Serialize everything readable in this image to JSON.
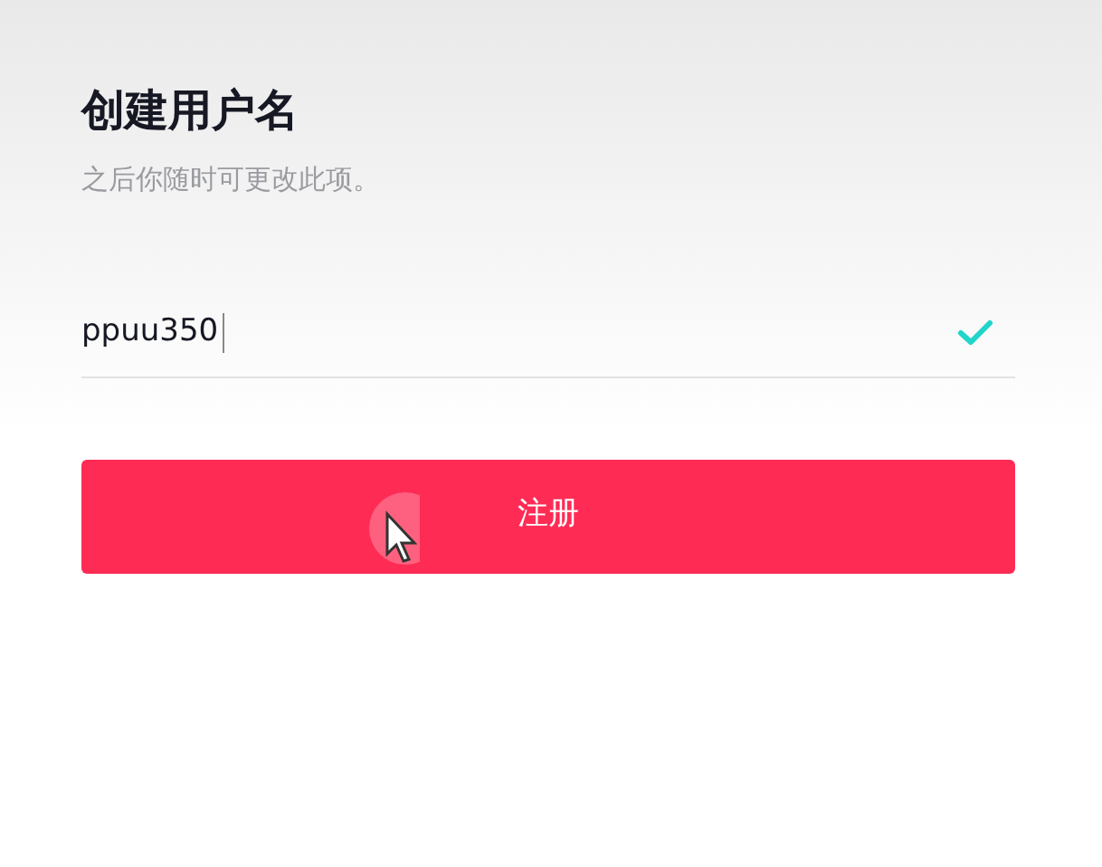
{
  "title": "创建用户名",
  "subtitle": "之后你随时可更改此项。",
  "username_field": {
    "value": "ppuu350",
    "focused": true,
    "valid": true
  },
  "submit_button": {
    "label": "注册"
  }
}
